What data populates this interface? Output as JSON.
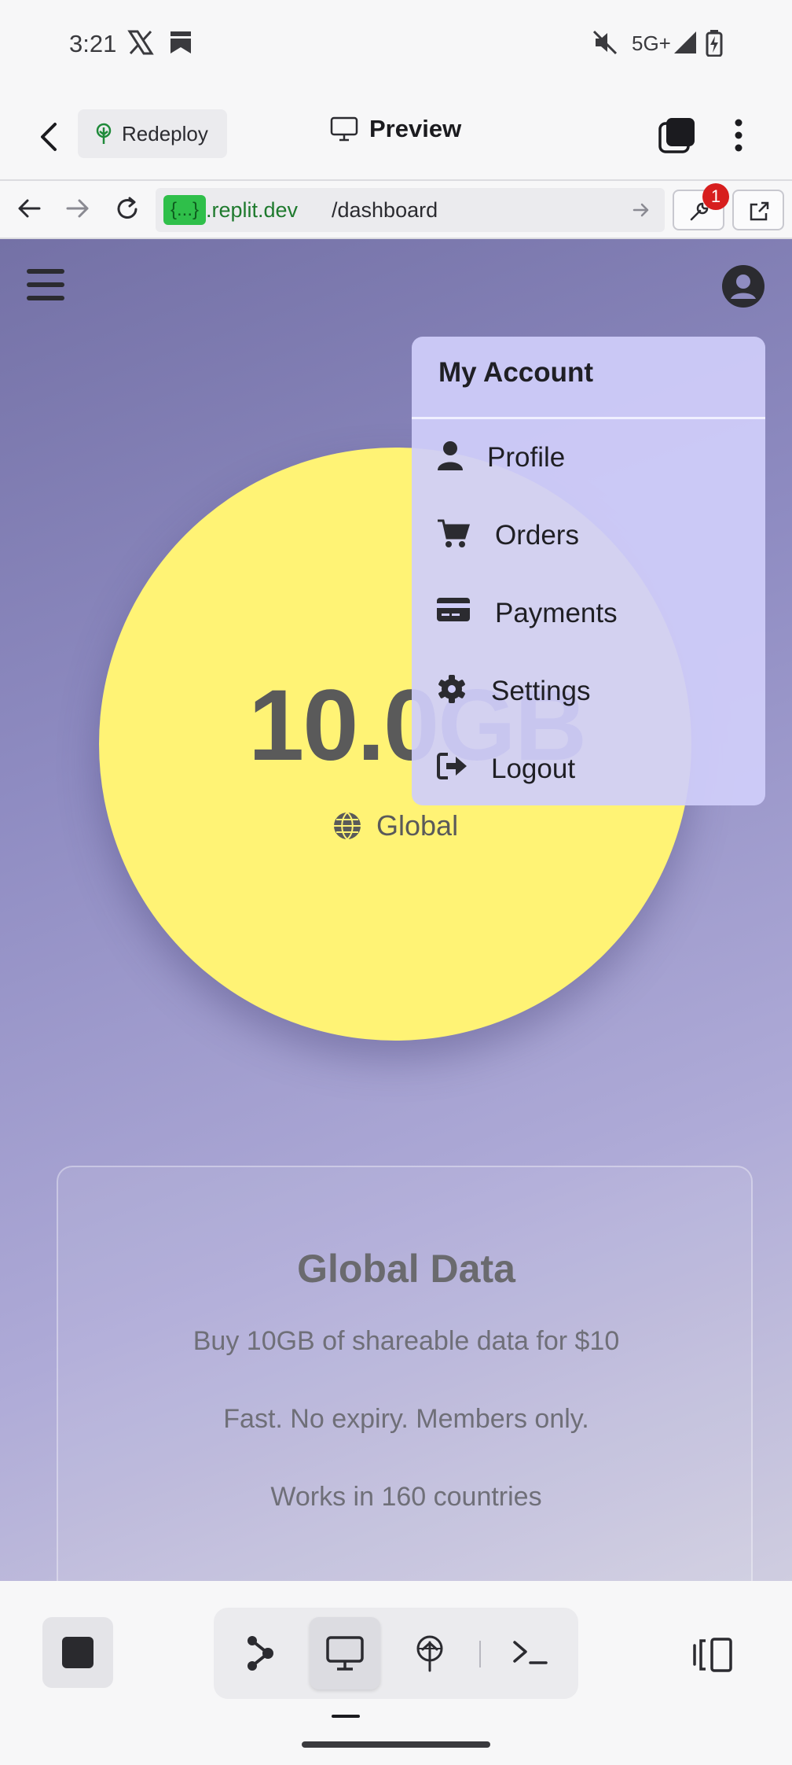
{
  "status_bar": {
    "time": "3:21",
    "network": "5G+",
    "icons": [
      "x-icon",
      "bookmark-icon",
      "mute-icon",
      "signal-icon",
      "battery-charging-icon"
    ]
  },
  "app_bar": {
    "redeploy_label": "Redeploy",
    "title": "Preview"
  },
  "url_bar": {
    "badge": "{...}",
    "host": ".replit.dev",
    "path": "/dashboard",
    "devtools_badge_count": "1"
  },
  "webpage": {
    "data_circle": {
      "amount": "10.0",
      "unit": "GB",
      "region": "Global"
    },
    "card": {
      "title": "Global Data",
      "lines": [
        "Buy 10GB of shareable data for $10",
        "Fast. No expiry. Members only.",
        "Works in 160 countries"
      ]
    },
    "account_menu": {
      "header": "My Account",
      "items": [
        {
          "label": "Profile",
          "icon": "user-icon"
        },
        {
          "label": "Orders",
          "icon": "cart-icon"
        },
        {
          "label": "Payments",
          "icon": "credit-card-icon"
        },
        {
          "label": "Settings",
          "icon": "gear-icon"
        },
        {
          "label": "Logout",
          "icon": "logout-icon"
        }
      ]
    }
  },
  "colors": {
    "circle": "#fff375",
    "menu": "#d0cefa",
    "page_gradient_start": "#7471a6",
    "page_gradient_end": "#cfcde0",
    "url_host": "#1f7a2e",
    "badge": "#d71e1e"
  }
}
